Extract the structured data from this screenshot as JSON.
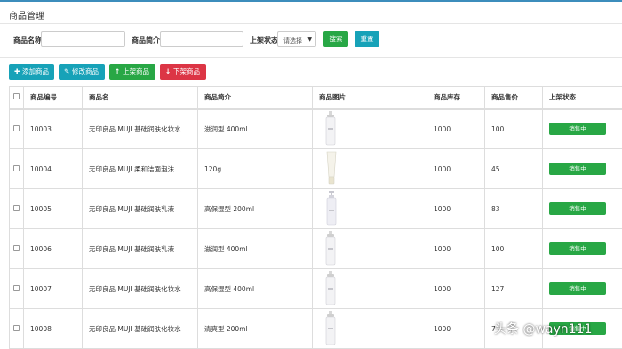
{
  "panel": {
    "title": "商品管理"
  },
  "search": {
    "name_label": "商品名称",
    "intro_label": "商品简介",
    "status_label": "上架状态",
    "status_selected": "请选择",
    "search_button": "搜索",
    "reset_button": "重置"
  },
  "toolbar": {
    "add": "添加商品",
    "edit": "修改商品",
    "up": "上架商品",
    "down": "下架商品"
  },
  "table": {
    "headers": [
      "商品编号",
      "商品名",
      "商品简介",
      "商品图片",
      "商品库存",
      "商品售价",
      "上架状态"
    ],
    "rows": [
      {
        "id": "10003",
        "name": "无印良品 MUJI 基础润肤化妆水",
        "intro": "滋润型 400ml",
        "image": "tall-bottle",
        "stock": "1000",
        "price": "100",
        "status": "销售中"
      },
      {
        "id": "10004",
        "name": "无印良品 MUJI 柔和洁面泡沫",
        "intro": "120g",
        "image": "tube",
        "stock": "1000",
        "price": "45",
        "status": "销售中"
      },
      {
        "id": "10005",
        "name": "无印良品 MUJI 基础润肤乳液",
        "intro": "高保湿型 200ml",
        "image": "pump-bottle",
        "stock": "1000",
        "price": "83",
        "status": "销售中"
      },
      {
        "id": "10006",
        "name": "无印良品 MUJI 基础润肤乳液",
        "intro": "滋润型 400ml",
        "image": "tall-bottle",
        "stock": "1000",
        "price": "100",
        "status": "销售中"
      },
      {
        "id": "10007",
        "name": "无印良品 MUJI 基础润肤化妆水",
        "intro": "高保湿型 400ml",
        "image": "tall-bottle",
        "stock": "1000",
        "price": "127",
        "status": "销售中"
      },
      {
        "id": "10008",
        "name": "无印良品 MUJI 基础润肤化妆水",
        "intro": "清爽型 200ml",
        "image": "tall-bottle",
        "stock": "1000",
        "price": "7",
        "status": "销售中"
      }
    ]
  },
  "watermark": "头条 @wayn111",
  "colors": {
    "accent": "#3c8dbc",
    "success": "#28a745",
    "info": "#17a2b8",
    "danger": "#dc3545"
  }
}
